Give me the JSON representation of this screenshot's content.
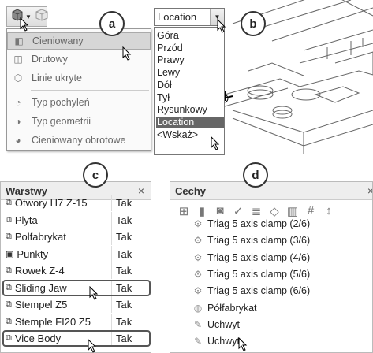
{
  "callouts": {
    "a": "a",
    "b": "b",
    "c": "c",
    "d": "d"
  },
  "panel_a": {
    "button_icons": [
      "cube-shaded-icon",
      "cube-wire-icon"
    ],
    "menu": [
      {
        "label": "Cieniowany",
        "icon": "cube-shaded-icon",
        "selected": true
      },
      {
        "label": "Drutowy",
        "icon": "cube-wire-icon"
      },
      {
        "label": "Linie ukryte",
        "icon": "cube-hidden-lines-icon"
      },
      {
        "label": "Typ pochyleń",
        "icon": "draft-type-icon"
      },
      {
        "label": "Typ geometrii",
        "icon": "geometry-type-icon"
      },
      {
        "label": "Cieniowany obrotowe",
        "icon": "shaded-rotate-icon"
      }
    ]
  },
  "panel_b": {
    "select_value": "Location",
    "options": [
      "Góra",
      "Przód",
      "Prawy",
      "Lewy",
      "Dół",
      "Tył",
      "Rysunkowy",
      "Location",
      "<Wskaż>"
    ],
    "selected": "Location"
  },
  "panel_c": {
    "title": "Warstwy",
    "close": "×",
    "rows": [
      {
        "name": "Otwory H7 Z-15",
        "value": "Tak",
        "icon": "layer-icon"
      },
      {
        "name": "Plyta",
        "value": "Tak",
        "icon": "layer-icon"
      },
      {
        "name": "Polfabrykat",
        "value": "Tak",
        "icon": "layer-icon"
      },
      {
        "name": "Punkty",
        "value": "Tak",
        "icon": "layer-active-icon"
      },
      {
        "name": "Rowek Z-4",
        "value": "Tak",
        "icon": "layer-icon"
      },
      {
        "name": "Sliding Jaw",
        "value": "Tak",
        "icon": "layer-icon",
        "highlighted": true
      },
      {
        "name": "Stempel Z5",
        "value": "Tak",
        "icon": "layer-icon"
      },
      {
        "name": "Stemple FI20 Z5",
        "value": "Tak",
        "icon": "layer-icon"
      },
      {
        "name": "Vice Body",
        "value": "Tak",
        "icon": "layer-icon",
        "highlighted": true
      }
    ]
  },
  "panel_d": {
    "title": "Cechy",
    "close": "×",
    "toolbar_icons": [
      "tree-icon",
      "features-icon",
      "bin-icon",
      "check-icon",
      "stack-icon",
      "diamond-icon",
      "chart-icon",
      "hash-icon",
      "sort-icon"
    ],
    "items": [
      {
        "label": "Triag 5 axis clamp (2/6)",
        "icon": "clamp-icon"
      },
      {
        "label": "Triag 5 axis clamp (3/6)",
        "icon": "clamp-icon"
      },
      {
        "label": "Triag 5 axis clamp (4/6)",
        "icon": "clamp-icon"
      },
      {
        "label": "Triag 5 axis clamp (5/6)",
        "icon": "clamp-icon"
      },
      {
        "label": "Triag 5 axis clamp (6/6)",
        "icon": "clamp-icon"
      },
      {
        "label": "Półfabrykat",
        "icon": "stock-icon"
      },
      {
        "label": "Uchwyt",
        "icon": "holder-icon"
      },
      {
        "label": "Uchwyt",
        "icon": "holder-icon"
      }
    ]
  }
}
